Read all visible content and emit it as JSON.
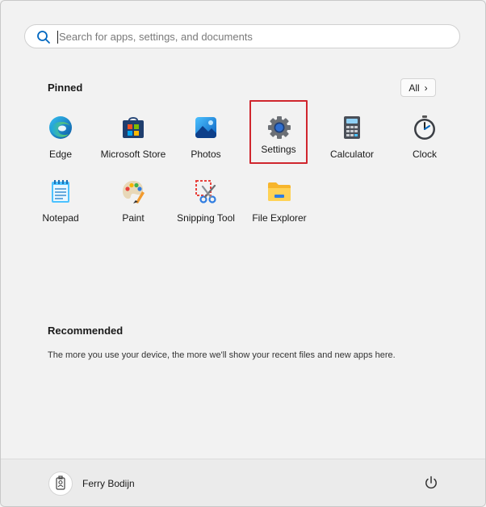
{
  "search": {
    "placeholder": "Search for apps, settings, and documents"
  },
  "pinned": {
    "title": "Pinned",
    "all_label": "All",
    "apps": [
      {
        "label": "Edge",
        "icon": "edge-icon"
      },
      {
        "label": "Microsoft Store",
        "icon": "store-icon"
      },
      {
        "label": "Photos",
        "icon": "photos-icon"
      },
      {
        "label": "Settings",
        "icon": "gear-icon",
        "selected": true
      },
      {
        "label": "Calculator",
        "icon": "calculator-icon"
      },
      {
        "label": "Clock",
        "icon": "clock-icon"
      },
      {
        "label": "Notepad",
        "icon": "notepad-icon"
      },
      {
        "label": "Paint",
        "icon": "paint-icon"
      },
      {
        "label": "Snipping Tool",
        "icon": "scissors-icon"
      },
      {
        "label": "File Explorer",
        "icon": "folder-icon"
      }
    ]
  },
  "recommended": {
    "title": "Recommended",
    "text": "The more you use your device, the more we'll show your recent files and new apps here."
  },
  "footer": {
    "user_name": "Ferry Bodijn"
  },
  "colors": {
    "highlight": "#d0262e",
    "accent": "#0067c0"
  }
}
